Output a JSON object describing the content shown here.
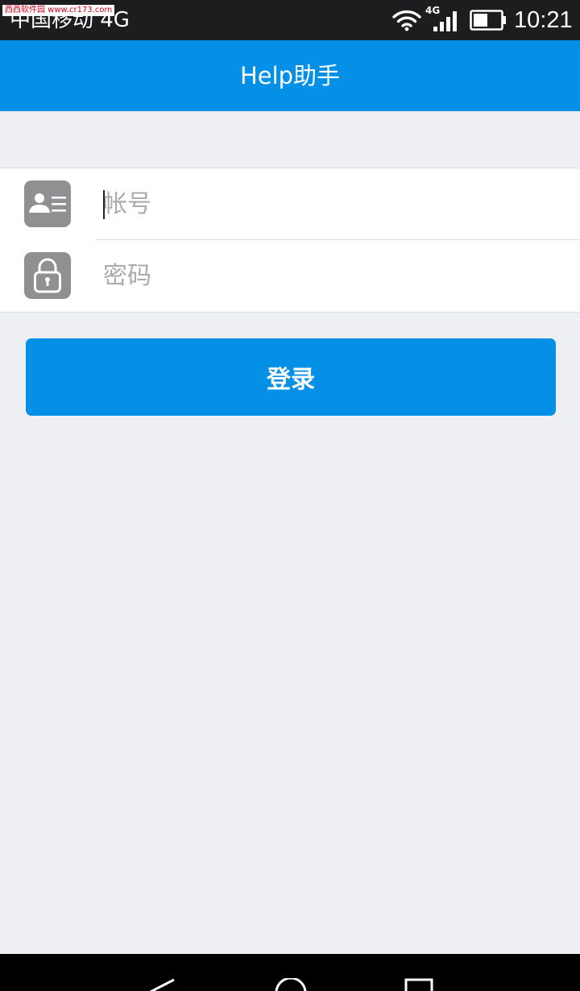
{
  "status_bar": {
    "watermark": "西西软件园 www.cr173.com",
    "carrier": "中国移动 4G",
    "network_type": "4G",
    "time": "10:21",
    "icons": [
      "wifi-icon",
      "signal-icon",
      "battery-icon"
    ]
  },
  "app_bar": {
    "title": "Help助手"
  },
  "login_form": {
    "account": {
      "placeholder": "帐号",
      "value": "",
      "icon": "contact-card-icon"
    },
    "password": {
      "placeholder": "密码",
      "value": "",
      "icon": "lock-icon"
    }
  },
  "login_button": {
    "label": "登录"
  },
  "nav_bar": {
    "icons": [
      "back-icon",
      "home-icon",
      "recents-icon"
    ]
  },
  "colors": {
    "primary": "#0590e8",
    "background": "#edeff2",
    "status_bar": "#1c1d1f",
    "icon_gray": "#8f9092",
    "placeholder": "#a9abae"
  }
}
